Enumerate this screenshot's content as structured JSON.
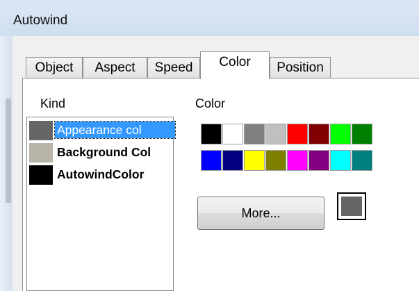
{
  "window": {
    "title": "Autowind"
  },
  "tabs": [
    {
      "label": "Object"
    },
    {
      "label": "Aspect"
    },
    {
      "label": "Speed"
    },
    {
      "label": "Color"
    },
    {
      "label": "Position"
    }
  ],
  "active_tab": "Color",
  "kind": {
    "label": "Kind",
    "items": [
      {
        "label": "Appearance col",
        "swatch_color": "#666666",
        "selected": true
      },
      {
        "label": "Background Col",
        "swatch_color": "#b8b4a8",
        "selected": false
      },
      {
        "label": "AutowindColor",
        "swatch_color": "#000000",
        "selected": false
      }
    ]
  },
  "color": {
    "label": "Color",
    "palette": [
      [
        "#000000",
        "#ffffff",
        "#808080",
        "#c0c0c0",
        "#ff0000",
        "#800000",
        "#00ff00",
        "#008000"
      ],
      [
        "#0000ff",
        "#000080",
        "#ffff00",
        "#808000",
        "#ff00ff",
        "#800080",
        "#00ffff",
        "#008080"
      ]
    ],
    "more_label": "More...",
    "current_color": "#666666"
  }
}
